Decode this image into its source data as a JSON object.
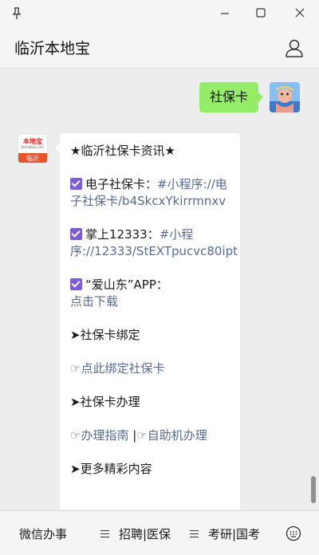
{
  "window": {
    "title": "临沂本地宝",
    "controls": [
      "pin-icon",
      "minimize-icon",
      "maximize-icon",
      "close-icon"
    ]
  },
  "outgoing_message": {
    "text": "社保卡"
  },
  "bot_avatar": {
    "logo_text": "本地宝",
    "sub_text": "bendibao.com",
    "city": "临沂"
  },
  "reply": {
    "heading": "★临沂社保卡资讯★",
    "item1_label": "电子社保卡：",
    "item1_link": "#小程序://电子社保卡/b4SkcxYkirrmnxv",
    "item2_label": "掌上12333：",
    "item2_link": "#小程序://12333/StEXTpucvc80ipt",
    "item3_label": "“爱山东”APP：",
    "item3_link": "点击下载",
    "section1": "➤社保卡绑定",
    "bind_link": "☞点此绑定社保卡",
    "section2": "➤社保卡办理",
    "guide_link": "☞办理指南",
    "separator": "|",
    "self_service_link": "☞自助机办理",
    "section3": "➤更多精彩内容"
  },
  "bottom_menu": [
    {
      "label": "微信办事"
    },
    {
      "label": "招聘|医保"
    },
    {
      "label": "考研|国考"
    }
  ],
  "colors": {
    "accent_green": "#95ec69",
    "link": "#576b95",
    "checkbox": "#7b5cd6"
  }
}
